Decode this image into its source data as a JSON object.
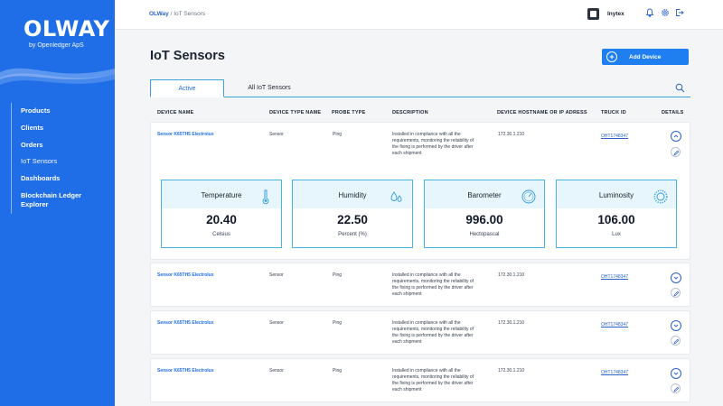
{
  "sidebar": {
    "logo": "OLWAY",
    "logo_sub": "by Openledger ApS",
    "items": [
      {
        "label": "Products"
      },
      {
        "label": "Clients"
      },
      {
        "label": "Orders"
      },
      {
        "label": "IoT Sensors"
      },
      {
        "label": "Dashboards"
      },
      {
        "label": "Blockchain Ledger Explorer"
      }
    ]
  },
  "topbar": {
    "breadcrumb_root": "OLWay",
    "breadcrumb_sep": " / ",
    "breadcrumb_current": "IoT Sensors",
    "company": "Inytex"
  },
  "page": {
    "title": "IoT Sensors",
    "add_button": "Add Device",
    "tabs": [
      "Active",
      "All IoT Sensors"
    ]
  },
  "table": {
    "headers": [
      "DEVICE NAME",
      "DEVICE TYPE NAME",
      "PROBE TYPE",
      "DESCRIPTION",
      "DEVICE HOSTNAME OR IP ADRESS",
      "TRUCK ID",
      "DETAILS"
    ],
    "rows": [
      {
        "name": "Sensor K65TH5 Electrolux",
        "type": "Sensor",
        "probe": "Ping",
        "desc_lines": [
          "Installed in compliance with all the",
          "requirements, monitoring the reliability of",
          "the fixing is performed by the driver after",
          "each shipment"
        ],
        "ip": "172.30.1.210",
        "truck": "OHT1748347"
      },
      {
        "name": "Sensor K65TH5 Electrolux",
        "type": "Sensor",
        "probe": "Ping",
        "desc_lines": [
          "Installed in compliance with all the",
          "requirements, monitoring the reliability of",
          "the fixing is performed by the driver after",
          "each shipment"
        ],
        "ip": "172.30.1.210",
        "truck": "OHT1748347"
      },
      {
        "name": "Sensor K65TH5 Electrolux",
        "type": "Sensor",
        "probe": "Ping",
        "desc_lines": [
          "Installed in compliance with all the",
          "requirements, monitoring the reliability of",
          "the fixing is performed by the driver after",
          "each shipment"
        ],
        "ip": "172.30.1.210",
        "truck": "OHT1748347"
      },
      {
        "name": "Sensor K65TH5 Electrolux",
        "type": "Sensor",
        "probe": "Ping",
        "desc_lines": [
          "Installed in compliance with all the",
          "requirements, monitoring the reliability of",
          "the fixing is performed by the driver after",
          "each shipment"
        ],
        "ip": "172.30.1.210",
        "truck": "OHT1748347"
      }
    ]
  },
  "metrics": [
    {
      "title": "Temperature",
      "value": "20.40",
      "unit": "Celsius",
      "icon": "thermometer-icon"
    },
    {
      "title": "Humidity",
      "value": "22.50",
      "unit": "Percent (%)",
      "icon": "droplets-icon"
    },
    {
      "title": "Barometer",
      "value": "996.00",
      "unit": "Hectopascal",
      "icon": "gauge-icon"
    },
    {
      "title": "Luminosity",
      "value": "106.00",
      "unit": "Lux",
      "icon": "sun-icon"
    }
  ],
  "colors": {
    "accent": "#1f6ee8",
    "sidebar": "#1f6ee8",
    "metric_border": "#4bb3e0",
    "metric_head": "#e7f5fc"
  }
}
